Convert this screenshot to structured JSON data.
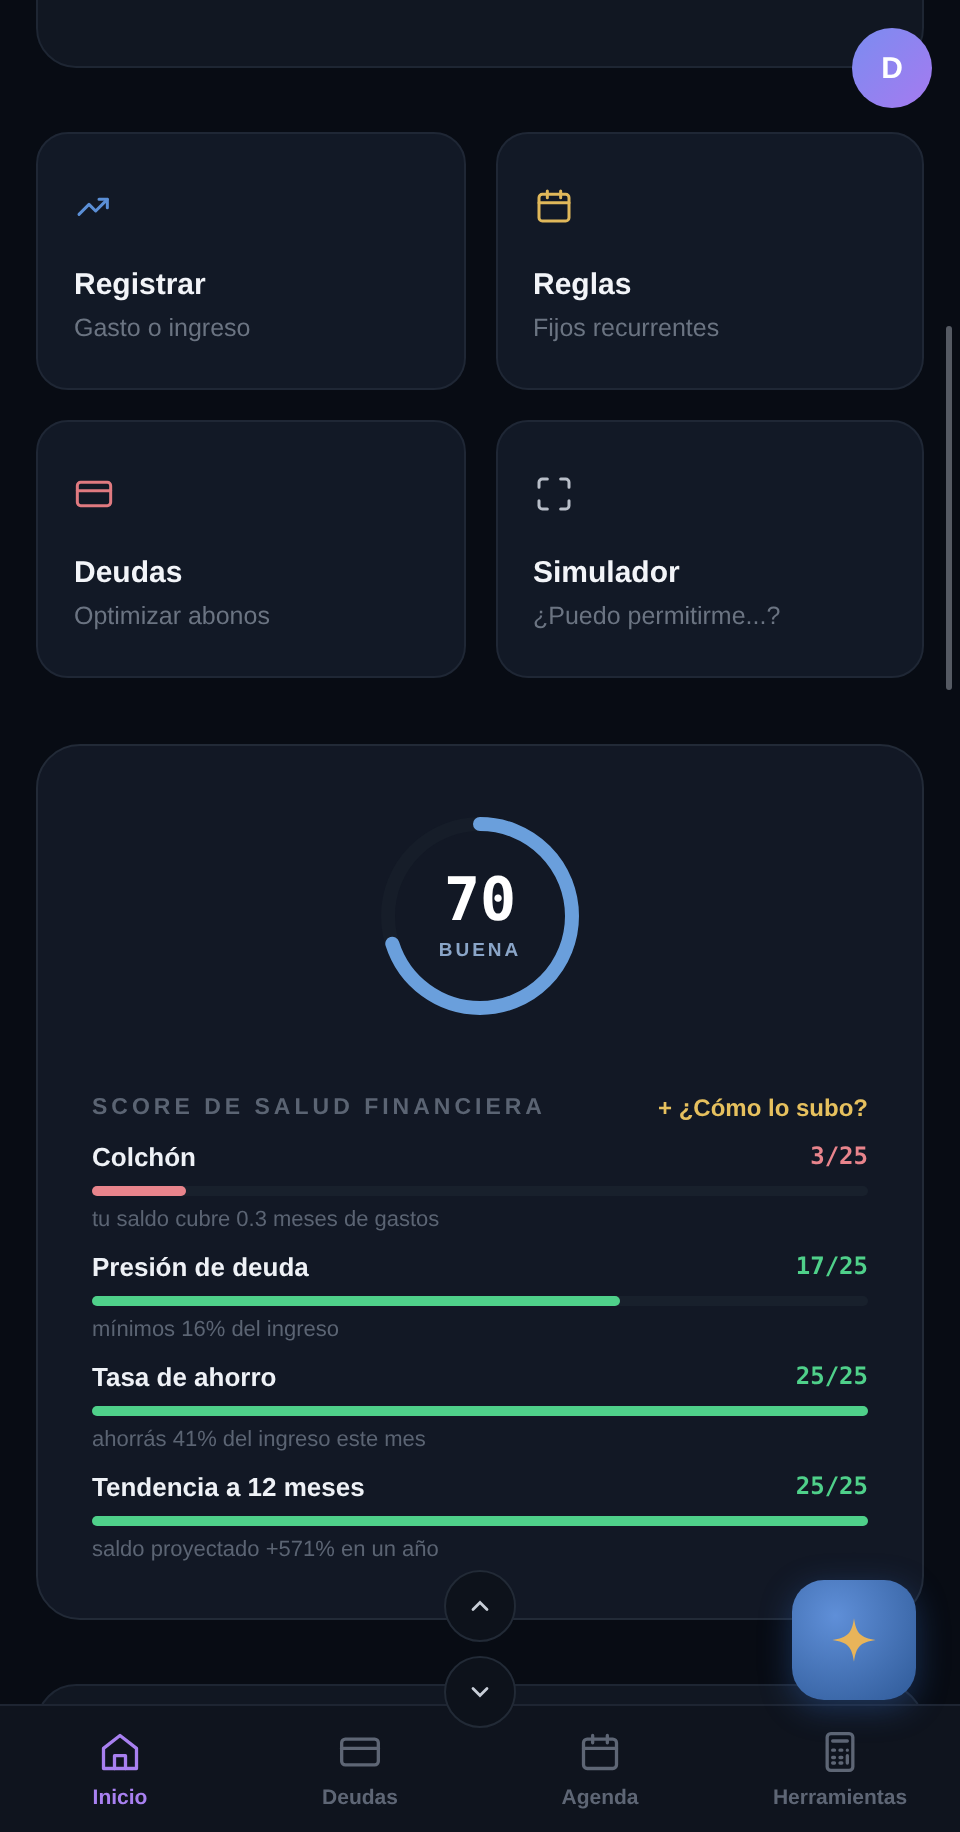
{
  "avatar": {
    "initial": "D"
  },
  "shortcuts": [
    {
      "title": "Registrar",
      "subtitle": "Gasto o ingreso",
      "kind": "trend",
      "color": "#5b8fd6"
    },
    {
      "title": "Reglas",
      "subtitle": "Fijos recurrentes",
      "kind": "calendar",
      "color": "#e0b85a"
    },
    {
      "title": "Deudas",
      "subtitle": "Optimizar abonos",
      "kind": "card",
      "color": "#e07a80"
    },
    {
      "title": "Simulador",
      "subtitle": "¿Puedo permitirme...?",
      "kind": "scan",
      "color": "#b8bec8"
    }
  ],
  "score": {
    "value": "70",
    "rating": "BUENA",
    "level": 0.7,
    "title": "SCORE DE SALUD FINANCIERA",
    "link": "+ ¿Cómo lo subo?",
    "metrics": [
      {
        "name": "Colchón",
        "score": "3/25",
        "level": 0.12,
        "color": "#e8848c",
        "note": "tu saldo cubre 0.3 meses de gastos"
      },
      {
        "name": "Presión de deuda",
        "score": "17/25",
        "level": 0.68,
        "color": "#4fd08a",
        "note": "mínimos 16% del ingreso"
      },
      {
        "name": "Tasa de ahorro",
        "score": "25/25",
        "level": 1,
        "color": "#4fd08a",
        "note": "ahorrás 41% del ingreso este mes"
      },
      {
        "name": "Tendencia a 12 meses",
        "score": "25/25",
        "level": 1,
        "color": "#4fd08a",
        "note": "saldo proyectado +571% en un año"
      }
    ]
  },
  "nav": [
    {
      "label": "Inicio",
      "kind": "home",
      "selected": true
    },
    {
      "label": "Deudas",
      "kind": "card",
      "selected": false
    },
    {
      "label": "Agenda",
      "kind": "calendar",
      "selected": false
    },
    {
      "label": "Herramientas",
      "kind": "calc",
      "selected": false
    }
  ]
}
